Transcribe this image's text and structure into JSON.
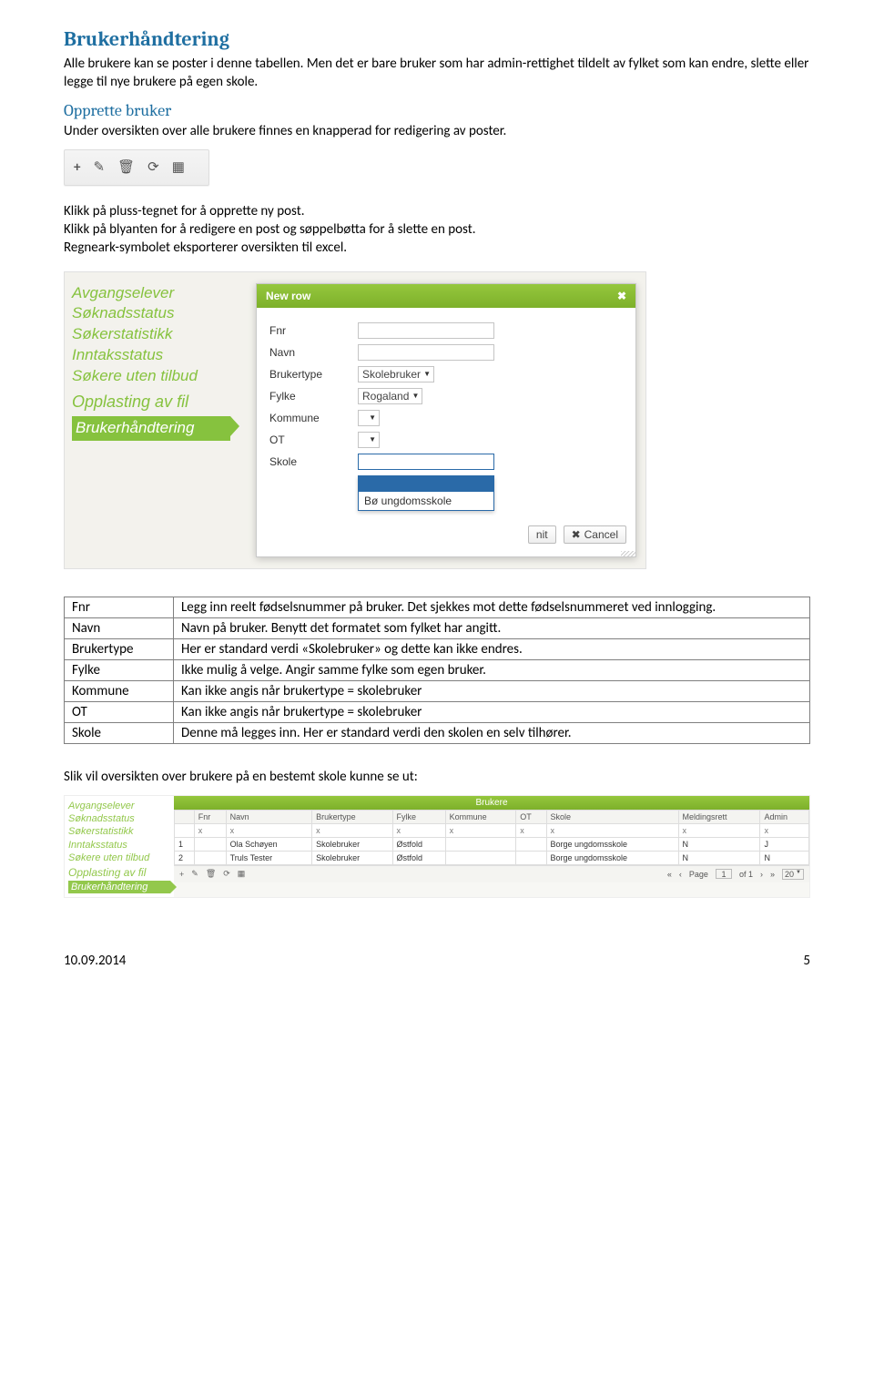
{
  "section": {
    "title": "Brukerhåndtering",
    "intro": "Alle brukere kan se poster i denne tabellen. Men det er bare bruker som har admin-rettighet tildelt av fylket som kan endre, slette eller legge til nye brukere på egen skole.",
    "sub_title": "Opprette bruker",
    "sub_intro": "Under oversikten over alle brukere finnes en knapperad for redigering av poster.",
    "instr1": "Klikk på pluss-tegnet for å opprette ny post.",
    "instr2": "Klikk på blyanten for å redigere en post og søppelbøtta for å slette en post.",
    "instr3": "Regneark-symbolet eksporterer oversikten til excel.",
    "overview_intro": "Slik vil oversikten over brukere på en bestemt skole kunne se ut:"
  },
  "nav": {
    "items": [
      "Avgangselever",
      "Søknadsstatus",
      "Søkerstatistikk",
      "Inntaksstatus",
      "Søkere uten tilbud"
    ],
    "section": "Opplasting av fil",
    "active": "Brukerhåndtering"
  },
  "modal": {
    "title": "New row",
    "labels": {
      "fnr": "Fnr",
      "navn": "Navn",
      "brukertype": "Brukertype",
      "fylke": "Fylke",
      "kommune": "Kommune",
      "ot": "OT",
      "skole": "Skole"
    },
    "values": {
      "brukertype": "Skolebruker",
      "fylke": "Rogaland",
      "skole_option": "Bø ungdomsskole"
    },
    "submit_suffix": "nit",
    "cancel": "Cancel"
  },
  "defs": {
    "rows": [
      {
        "k": "Fnr",
        "v": "Legg inn reelt fødselsnummer på bruker. Det sjekkes mot dette fødselsnummeret ved innlogging."
      },
      {
        "k": "Navn",
        "v": "Navn på bruker. Benytt det formatet som fylket har angitt."
      },
      {
        "k": "Brukertype",
        "v": "Her er standard verdi «Skolebruker» og dette kan ikke endres."
      },
      {
        "k": "Fylke",
        "v": "Ikke mulig å velge. Angir samme fylke som egen bruker."
      },
      {
        "k": "Kommune",
        "v": "Kan ikke angis når brukertype = skolebruker"
      },
      {
        "k": "OT",
        "v": "Kan ikke angis når brukertype = skolebruker"
      },
      {
        "k": "Skole",
        "v": "Denne må legges inn. Her er standard verdi den skolen en selv tilhører."
      }
    ]
  },
  "overview": {
    "title": "Brukere",
    "headers": [
      "Fnr",
      "Navn",
      "Brukertype",
      "Fylke",
      "Kommune",
      "OT",
      "Skole",
      "Meldingsrett",
      "Admin"
    ],
    "rows": [
      {
        "n": "1",
        "cells": [
          "",
          "Ola Schøyen",
          "Skolebruker",
          "Østfold",
          "",
          "",
          "Borge ungdomsskole",
          "N",
          "J"
        ]
      },
      {
        "n": "2",
        "cells": [
          "",
          "Truls Tester",
          "Skolebruker",
          "Østfold",
          "",
          "",
          "Borge ungdomsskole",
          "N",
          "N"
        ]
      }
    ],
    "pager": {
      "page_label": "Page",
      "page": "1",
      "of_label": "of 1",
      "size": "20"
    }
  },
  "footer": {
    "date": "10.09.2014",
    "page": "5"
  }
}
